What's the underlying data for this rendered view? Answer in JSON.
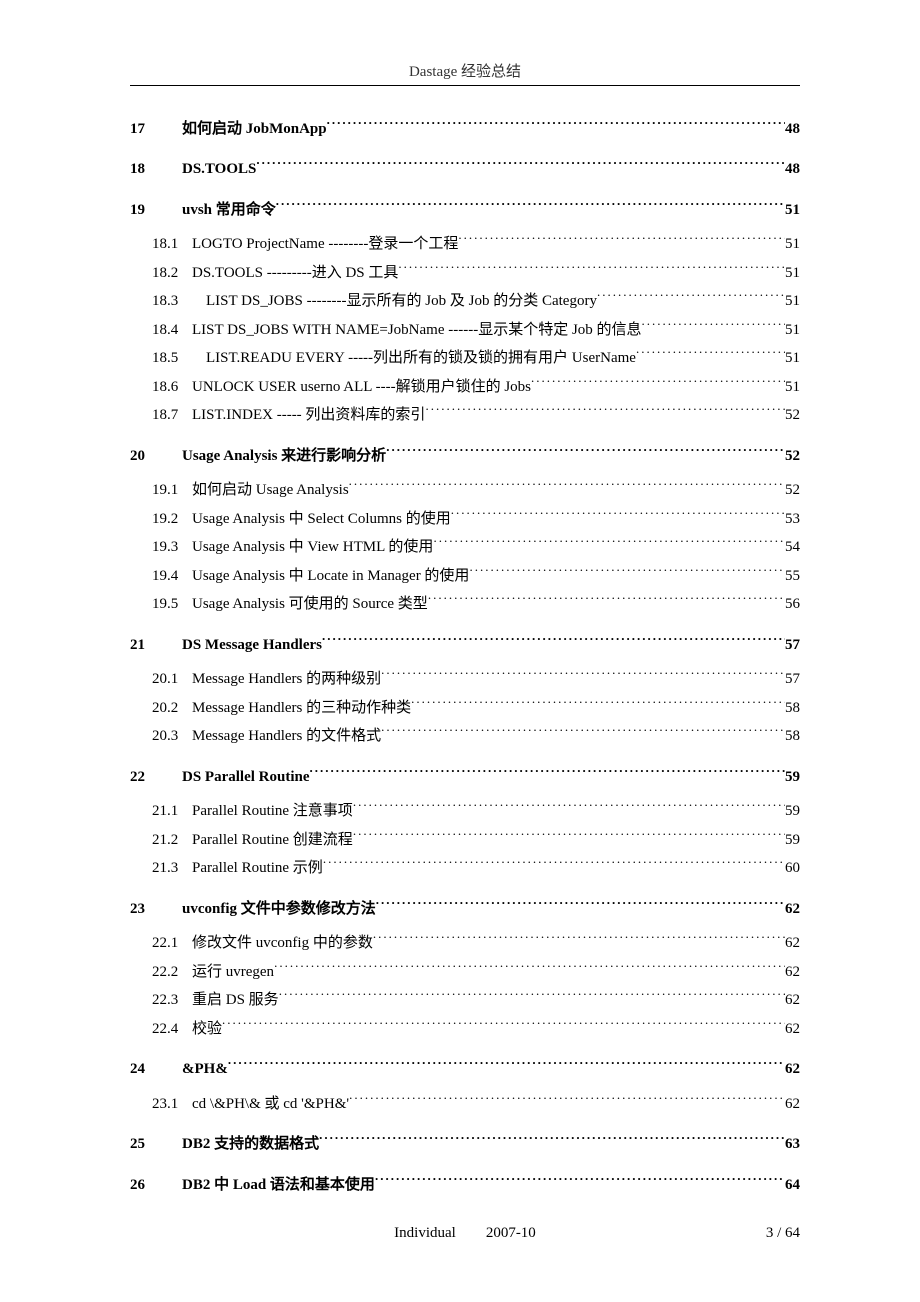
{
  "header": "Dastage 经验总结",
  "footer": {
    "left": "Individual",
    "center": "2007-10",
    "right": "3 / 64"
  },
  "toc": [
    {
      "l": 1,
      "n": "17",
      "t": "如何启动 JobMonApp",
      "p": "48"
    },
    {
      "l": 1,
      "n": "18",
      "t": "DS.TOOLS",
      "p": "48"
    },
    {
      "l": 1,
      "n": "19",
      "t": "uvsh 常用命令",
      "p": "51"
    },
    {
      "l": 2,
      "n": "18.1",
      "t": "LOGTO ProjectName --------登录一个工程",
      "p": "51"
    },
    {
      "l": 2,
      "n": "18.2",
      "t": "DS.TOOLS ---------进入 DS 工具",
      "p": "51"
    },
    {
      "l": 2,
      "n": "18.3",
      "t": "LIST DS_JOBS --------显示所有的 Job 及 Job 的分类 Category",
      "p": "51",
      "indent": true
    },
    {
      "l": 2,
      "n": "18.4",
      "t": "LIST DS_JOBS WITH NAME=JobName ------显示某个特定 Job 的信息",
      "p": "51"
    },
    {
      "l": 2,
      "n": "18.5",
      "t": "LIST.READU EVERY -----列出所有的锁及锁的拥有用户 UserName",
      "p": "51",
      "indent": true
    },
    {
      "l": 2,
      "n": "18.6",
      "t": "UNLOCK USER userno ALL ----解锁用户锁住的 Jobs",
      "p": "51"
    },
    {
      "l": 2,
      "n": "18.7",
      "t": "LIST.INDEX ----- 列出资料库的索引",
      "p": "52"
    },
    {
      "l": 1,
      "n": "20",
      "t": "Usage Analysis 来进行影响分析",
      "p": "52"
    },
    {
      "l": 2,
      "n": "19.1",
      "t": "如何启动 Usage Analysis",
      "p": "52"
    },
    {
      "l": 2,
      "n": "19.2",
      "t": "Usage Analysis 中 Select Columns 的使用",
      "p": "53"
    },
    {
      "l": 2,
      "n": "19.3",
      "t": "Usage Analysis 中 View HTML 的使用",
      "p": "54"
    },
    {
      "l": 2,
      "n": "19.4",
      "t": "Usage Analysis 中 Locate in Manager 的使用",
      "p": "55"
    },
    {
      "l": 2,
      "n": "19.5",
      "t": "Usage Analysis 可使用的 Source 类型",
      "p": "56"
    },
    {
      "l": 1,
      "n": "21",
      "t": "DS Message Handlers",
      "p": "57"
    },
    {
      "l": 2,
      "n": "20.1",
      "t": "Message Handlers 的两种级别",
      "p": "57"
    },
    {
      "l": 2,
      "n": "20.2",
      "t": "Message Handlers 的三种动作种类",
      "p": "58"
    },
    {
      "l": 2,
      "n": "20.3",
      "t": "Message Handlers 的文件格式",
      "p": "58"
    },
    {
      "l": 1,
      "n": "22",
      "t": "DS Parallel Routine",
      "p": "59"
    },
    {
      "l": 2,
      "n": "21.1",
      "t": "Parallel Routine 注意事项",
      "p": "59"
    },
    {
      "l": 2,
      "n": "21.2",
      "t": "Parallel Routine 创建流程",
      "p": "59"
    },
    {
      "l": 2,
      "n": "21.3",
      "t": "Parallel Routine 示例",
      "p": "60"
    },
    {
      "l": 1,
      "n": "23",
      "t": "uvconfig 文件中参数修改方法",
      "p": "62"
    },
    {
      "l": 2,
      "n": "22.1",
      "t": "修改文件 uvconfig 中的参数",
      "p": "62"
    },
    {
      "l": 2,
      "n": "22.2",
      "t": "运行 uvregen",
      "p": "62"
    },
    {
      "l": 2,
      "n": "22.3",
      "t": "重启 DS 服务",
      "p": "62"
    },
    {
      "l": 2,
      "n": "22.4",
      "t": "校验",
      "p": "62"
    },
    {
      "l": 1,
      "n": "24",
      "t": "&PH&",
      "p": "62"
    },
    {
      "l": 2,
      "n": "23.1",
      "t": "cd \\&PH\\& 或 cd '&PH&'",
      "p": "62"
    },
    {
      "l": 1,
      "n": "25",
      "t": "DB2 支持的数据格式",
      "p": "63"
    },
    {
      "l": 1,
      "n": "26",
      "t": "DB2 中 Load 语法和基本使用",
      "p": "64"
    }
  ]
}
